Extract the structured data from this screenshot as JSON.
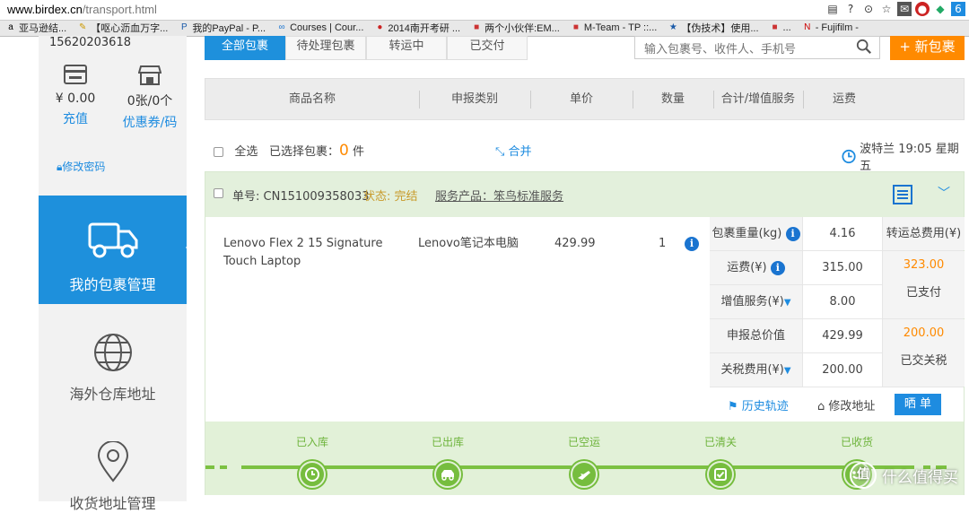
{
  "browser": {
    "url_domain": "www.birdex.cn",
    "url_path": "/transport.html",
    "bookmarks": [
      {
        "icon": "a-icon",
        "label": "亚马逊结..."
      },
      {
        "icon": "pen-icon",
        "label": "【呕心沥血万字..."
      },
      {
        "icon": "p-icon",
        "label": "我的PayPal - P..."
      },
      {
        "icon": "infinity-icon",
        "label": "Courses | Cour..."
      },
      {
        "icon": "bomb-icon",
        "label": "2014南开考研 ..."
      },
      {
        "icon": "square-icon",
        "label": "两个小伙伴:EM..."
      },
      {
        "icon": "square-icon",
        "label": "M-Team - TP ::..."
      },
      {
        "icon": "star-icon",
        "label": "【伪技术】使用..."
      },
      {
        "icon": "square-icon",
        "label": "..."
      },
      {
        "icon": "n-icon",
        "label": "- Fujifilm -"
      }
    ]
  },
  "sidebar": {
    "phone": "15620203618",
    "balance_value": "¥ 0.00",
    "balance_action": "充值",
    "coupon_value": "0张/0个",
    "coupon_action": "优惠券/码",
    "change_password": "修改密码",
    "nav": [
      {
        "label": "我的包裹管理",
        "active": true
      },
      {
        "label": "海外仓库地址",
        "active": false
      },
      {
        "label": "收货地址管理",
        "active": false
      }
    ]
  },
  "tabs": [
    "全部包裹",
    "待处理包裹",
    "转运中",
    "已交付"
  ],
  "search": {
    "placeholder": "输入包裹号、收件人、手机号"
  },
  "new_package_label": "+ 新包裹",
  "table_headers": [
    "商品名称",
    "申报类别",
    "单价",
    "数量",
    "合计/增值服务",
    "运费"
  ],
  "select_bar": {
    "select_all": "全选",
    "selected_prefix": "已选择包裹：",
    "selected_count": "0",
    "selected_unit": "件",
    "merge": "合并",
    "clock_text": "波特兰 19:05 星期五"
  },
  "package": {
    "order_no": "单号: CN151009358033",
    "status": "状态: 完结",
    "service": "服务产品：笨鸟标准服务",
    "item": {
      "name": "Lenovo Flex 2 15 Signature Touch Laptop",
      "category": "Lenovo笔记本电脑",
      "price": "429.99",
      "qty": "1"
    },
    "fees": [
      {
        "label": "包裹重量(kg)",
        "value": "4.16"
      },
      {
        "label": "运费(¥)",
        "value": "315.00"
      },
      {
        "label": "增值服务(¥)",
        "value": "8.00"
      },
      {
        "label": "申报总价值",
        "value": "429.99"
      },
      {
        "label": "关税费用(¥)",
        "value": "200.00"
      }
    ],
    "total_header": "转运总费用(¥)",
    "total_value": "323.00",
    "total_status": "已支付",
    "tax_value": "200.00",
    "tax_status": "已交关税",
    "actions": {
      "history": "历史轨迹",
      "modify_address": "修改地址",
      "share": "晒 单"
    },
    "progress": [
      "已入库",
      "已出库",
      "已空运",
      "已清关",
      "已收货"
    ]
  },
  "watermark": "什么值得买",
  "colors": {
    "accent": "#1e90dc",
    "orange": "#ff8a00",
    "green": "#76bd3e"
  }
}
